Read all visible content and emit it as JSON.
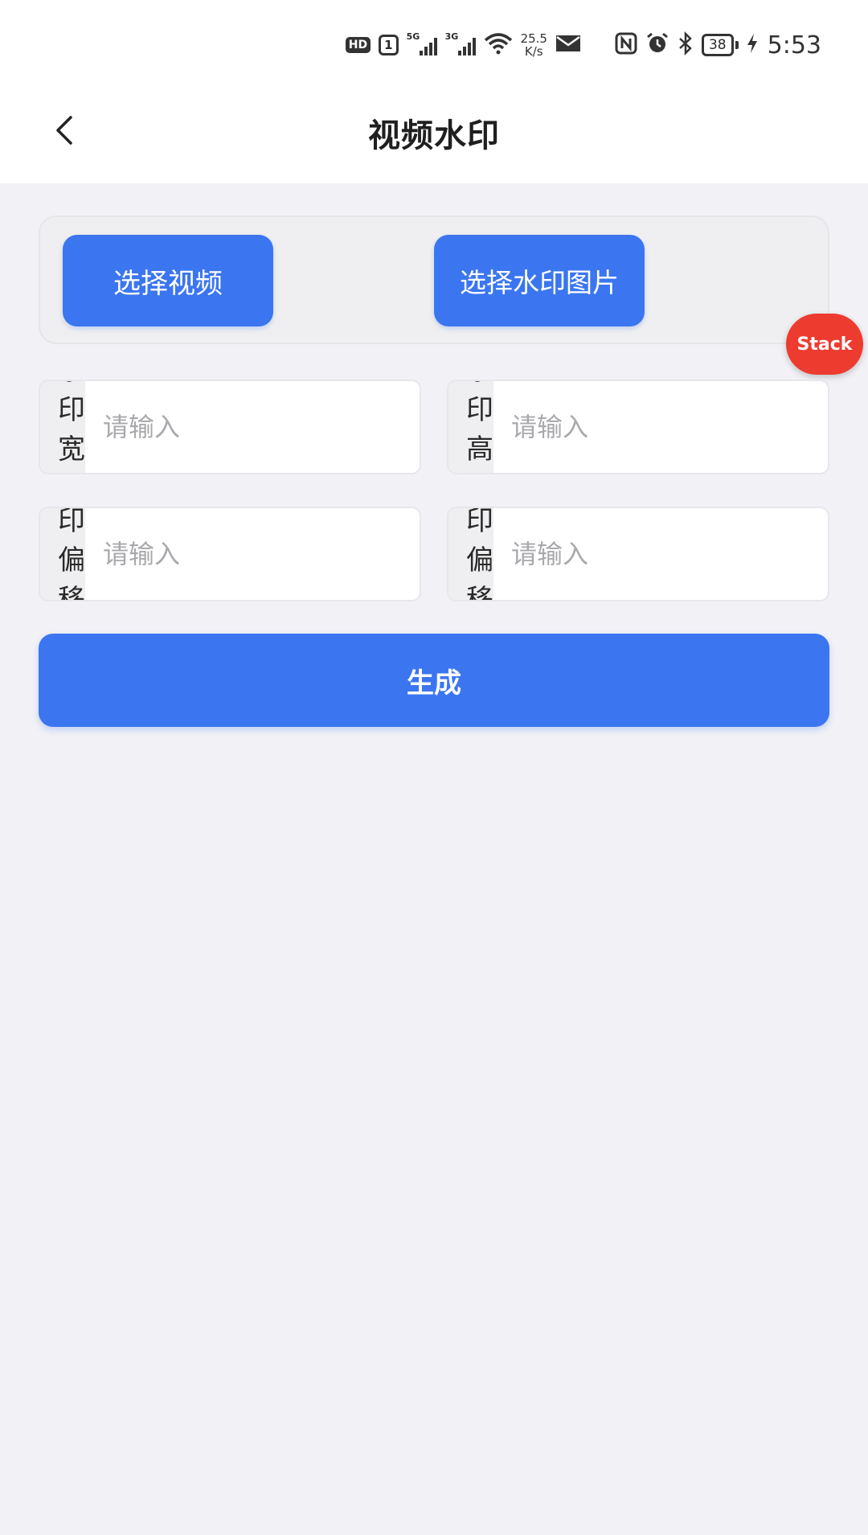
{
  "status_bar": {
    "hd": "HD",
    "sim": "1",
    "net1": "5G",
    "net2": "3G",
    "speed_value": "25.5",
    "speed_unit": "K/s",
    "battery": "38",
    "time": "5:53"
  },
  "nav": {
    "title": "视频水印"
  },
  "actions": {
    "select_video": "选择视频",
    "select_watermark": "选择水印图片"
  },
  "badge": {
    "label": "Stack"
  },
  "fields": {
    "width_label": "水印宽度",
    "height_label": "水印高度",
    "offset_x_label": "水印偏移X",
    "offset_y_label": "水印偏移Y",
    "placeholder": "请输入"
  },
  "generate": {
    "label": "生成"
  },
  "colors": {
    "primary": "#3b76f0",
    "badge": "#ee3b2f",
    "background": "#f1f1f6"
  }
}
